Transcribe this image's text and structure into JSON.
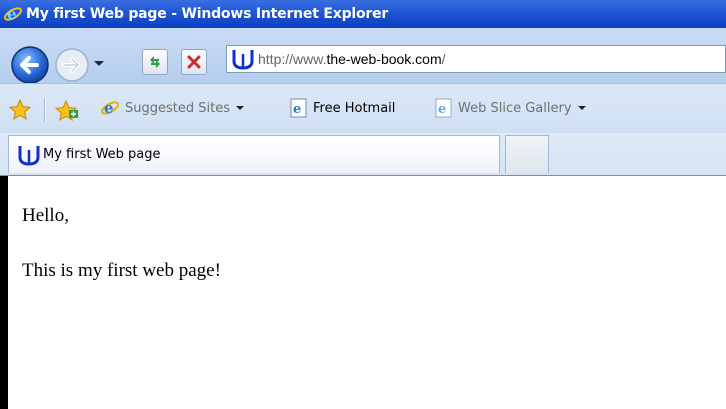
{
  "window": {
    "title": "My first Web page - Windows Internet Explorer"
  },
  "navbar": {
    "address": {
      "prefix": "http://www.",
      "domain": "the-web-book.com",
      "suffix": "/"
    },
    "icons": [
      "back-arrow-icon",
      "forward-arrow-icon",
      "refresh-icon",
      "stop-icon",
      "site-favicon"
    ]
  },
  "favorites_bar": {
    "items": [
      {
        "label": "Suggested Sites",
        "icon": "ie-icon",
        "has_dropdown": true
      },
      {
        "label": "Free Hotmail",
        "icon": "ie-page-icon",
        "has_dropdown": false
      },
      {
        "label": "Web Slice Gallery",
        "icon": "ie-page-icon",
        "has_dropdown": true
      }
    ]
  },
  "tabs": [
    {
      "label": "My first Web page",
      "active": true
    }
  ],
  "page": {
    "paragraphs": [
      "Hello,",
      "This is my first web page!"
    ]
  },
  "colors": {
    "titlebar": "#1f56d6",
    "toolbar": "#c9dcf5",
    "favorites_bar": "#dce8f7",
    "content_bg": "#ffffff"
  }
}
